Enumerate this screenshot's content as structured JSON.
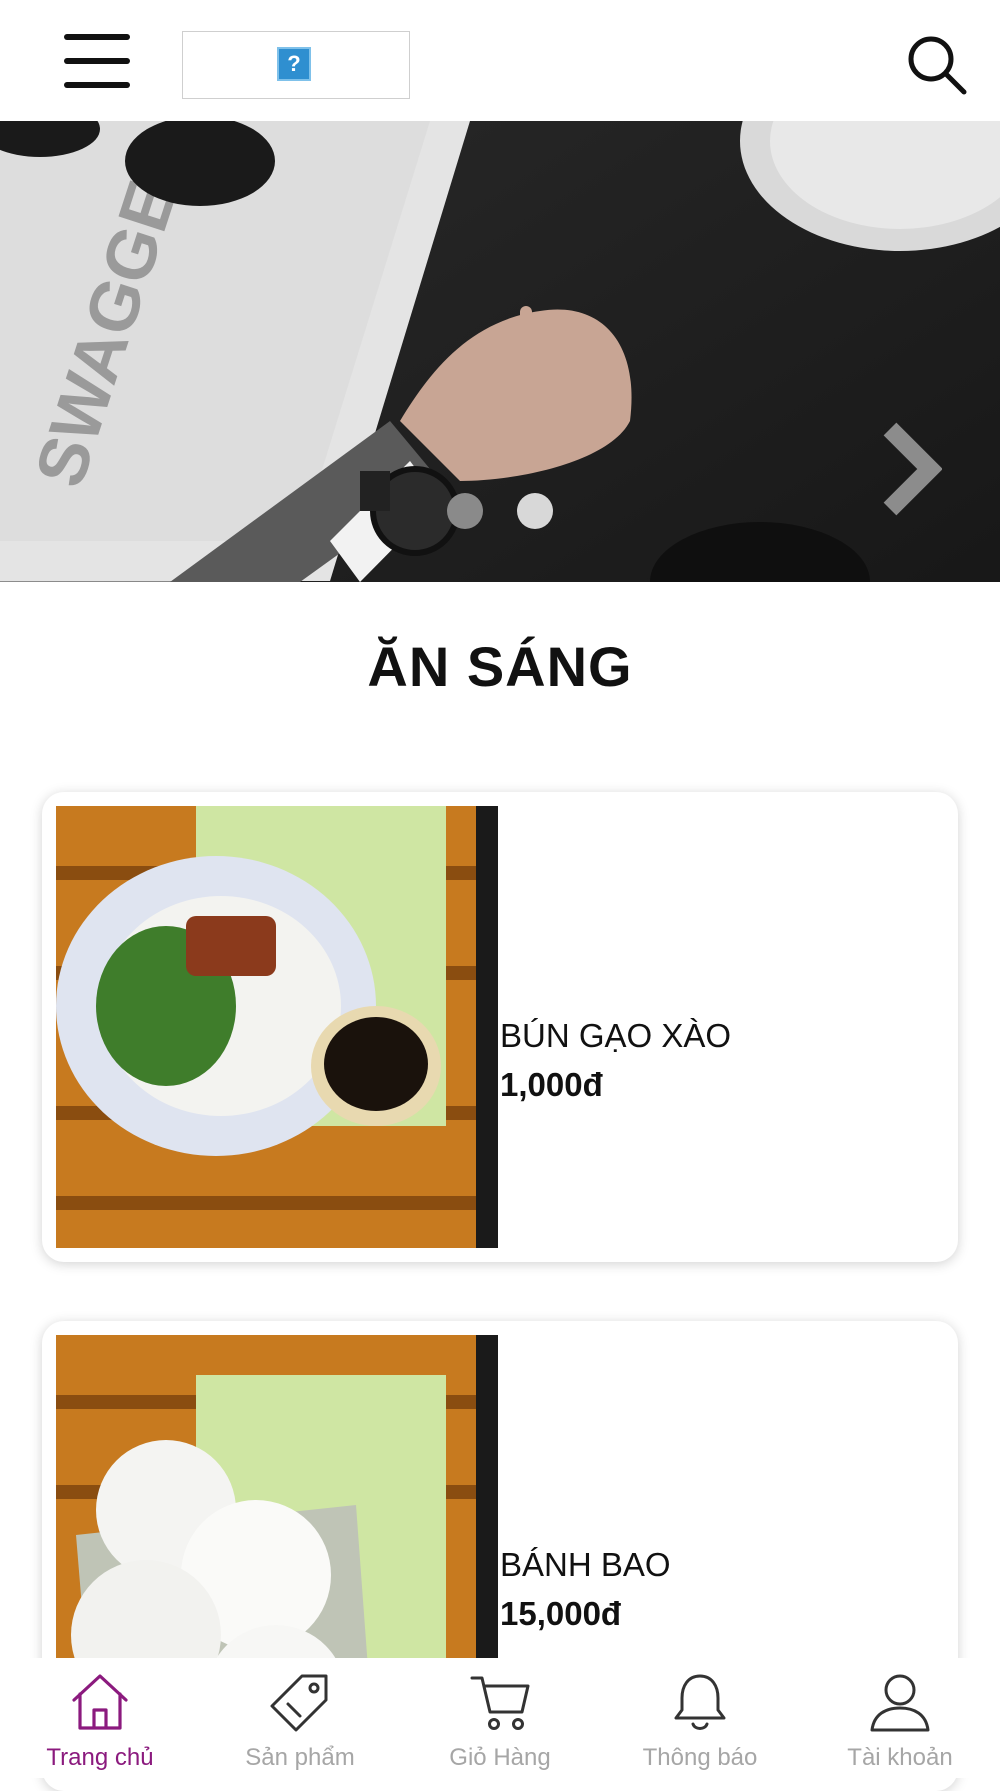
{
  "header": {
    "menu_icon": "hamburger-menu-icon",
    "logo_icon": "broken-image-icon",
    "logo_glyph": "?",
    "search_icon": "search-icon"
  },
  "hero": {
    "next_icon": "chevron-right-icon",
    "slides_count_visible": 2,
    "active_slide": 2
  },
  "section": {
    "title": "ĂN SÁNG"
  },
  "products": [
    {
      "name": "BÚN GẠO XÀO",
      "price": "1,000đ"
    },
    {
      "name": "BÁNH BAO",
      "price": "15,000đ"
    }
  ],
  "bottom_nav": {
    "items": [
      {
        "label": "Trang chủ",
        "icon": "home-icon",
        "active": true
      },
      {
        "label": "Sản phẩm",
        "icon": "tag-icon",
        "active": false
      },
      {
        "label": "Giỏ Hàng",
        "icon": "cart-icon",
        "active": false
      },
      {
        "label": "Thông báo",
        "icon": "bell-icon",
        "active": false
      },
      {
        "label": "Tài khoản",
        "icon": "user-icon",
        "active": false
      }
    ]
  },
  "colors": {
    "accent": "#8b1a7e",
    "inactive": "#a6a6a6",
    "text": "#111111"
  }
}
